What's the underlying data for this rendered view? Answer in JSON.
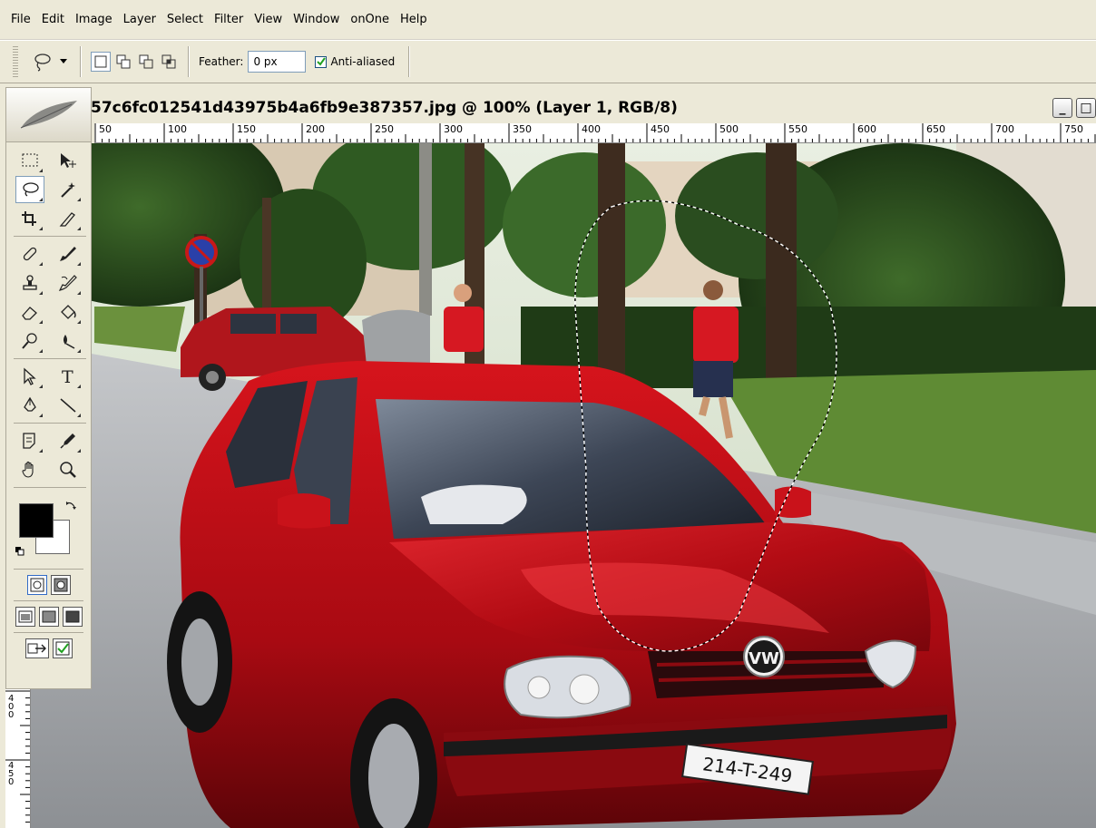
{
  "menu": [
    "File",
    "Edit",
    "Image",
    "Layer",
    "Select",
    "Filter",
    "View",
    "Window",
    "onOne",
    "Help"
  ],
  "options": {
    "feather_label": "Feather:",
    "feather_value": "0 px",
    "anti_aliased_label": "Anti-aliased",
    "anti_aliased_checked": true
  },
  "document": {
    "title": "57c6fc012541d43975b4a6fb9e387357.jpg @ 100% (Layer 1, RGB/8)",
    "minimize": "_",
    "maximize": "□"
  },
  "ruler": {
    "h_labels": [
      "50",
      "100",
      "150",
      "200",
      "250",
      "300",
      "350",
      "400",
      "450",
      "500",
      "550",
      "600",
      "650",
      "700",
      "750"
    ],
    "v_labels": [
      "400",
      "450"
    ]
  },
  "photo": {
    "plate_text": "214-T-249",
    "brand_logo": "VW"
  },
  "colors": {
    "foreground": "#000000",
    "background": "#ffffff",
    "accent": "#316ac5"
  },
  "icons": [
    "lasso-icon",
    "marquee-icon",
    "move-icon",
    "magic-wand-icon",
    "crop-icon",
    "slice-icon",
    "healing-brush-icon",
    "brush-icon",
    "clone-stamp-icon",
    "history-brush-icon",
    "eraser-icon",
    "paint-bucket-icon",
    "dodge-icon",
    "blur-icon",
    "path-selection-icon",
    "type-icon",
    "pen-icon",
    "line-icon",
    "notes-icon",
    "eyedropper-icon",
    "hand-icon",
    "zoom-icon"
  ]
}
